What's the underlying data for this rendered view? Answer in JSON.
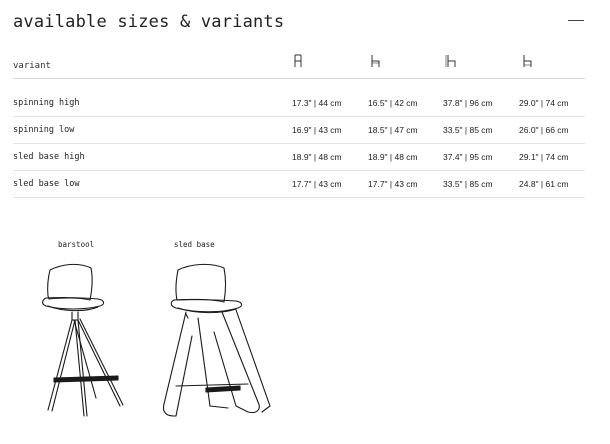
{
  "section": {
    "title": "available sizes & variants"
  },
  "table": {
    "variant_header": "variant",
    "column_icons": [
      "seat-height-icon",
      "seat-depth-icon",
      "overall-height-icon",
      "overall-width-icon"
    ],
    "rows": [
      {
        "name": "spinning high",
        "values": [
          "17.3\" | 44 cm",
          "16.5\" | 42 cm",
          "37.8\" | 96 cm",
          "29.0\" | 74 cm"
        ]
      },
      {
        "name": "spinning low",
        "values": [
          "16.9\" | 43 cm",
          "18.5\" | 47 cm",
          "33.5\" | 85 cm",
          "26.0\" | 66 cm"
        ]
      },
      {
        "name": "sled base high",
        "values": [
          "18.9\" | 48 cm",
          "18.9\" | 48 cm",
          "37.4\" | 95 cm",
          "29.1\" | 74 cm"
        ]
      },
      {
        "name": "sled base low",
        "values": [
          "17.7\" | 43 cm",
          "17.7\" | 43 cm",
          "33.5\" | 85 cm",
          "24.8\" | 61 cm"
        ]
      }
    ]
  },
  "drawings": {
    "barstool_label": "barstool",
    "sled_label": "sled base"
  }
}
